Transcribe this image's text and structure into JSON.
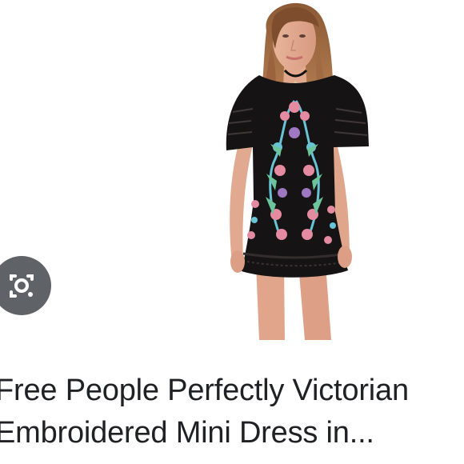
{
  "product": {
    "title_line1": "Free People Perfectly Victorian",
    "title_line2": "Embroidered Mini Dress in..."
  },
  "image": {
    "subject": "model wearing black embroidered mini dress with floral embroidery"
  },
  "lens_button": {
    "icon": "camera-search-icon"
  },
  "colors": {
    "dress": "#151313",
    "embroidery_pink": "#e48aa1",
    "embroidery_blue": "#68c3d6",
    "embroidery_green": "#6cc59a",
    "lens_bg": "#5f6368",
    "text": "#202124"
  }
}
